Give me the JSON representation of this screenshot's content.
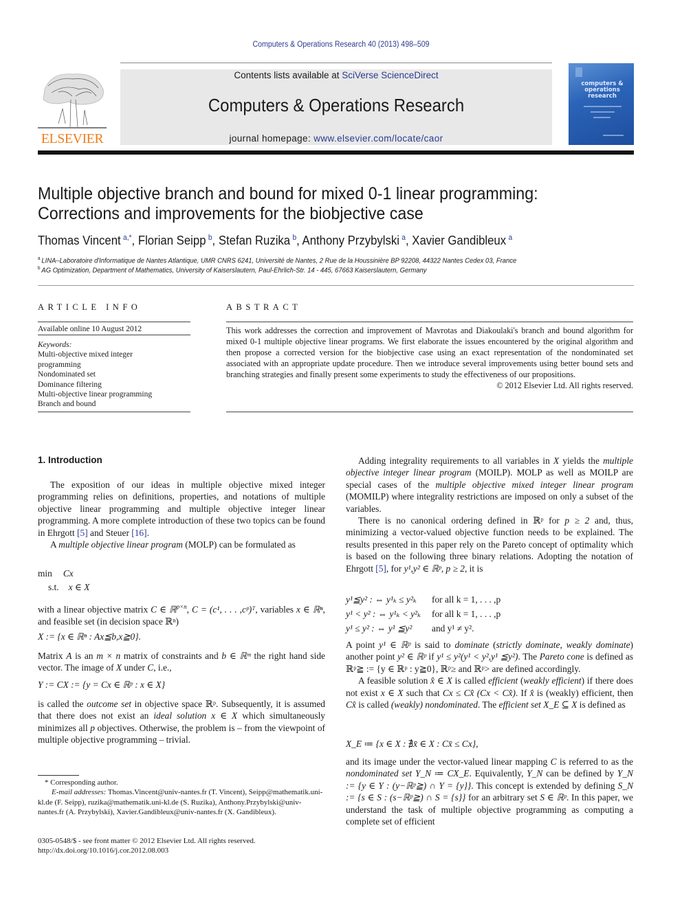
{
  "header": {
    "journal_reference": "Computers & Operations Research 40 (2013) 498–509",
    "contents_prefix": "Contents lists available at ",
    "contents_link": "SciVerse ScienceDirect",
    "journal_name": "Computers & Operations Research",
    "homepage_prefix": "journal homepage: ",
    "homepage_link": "www.elsevier.com/locate/caor",
    "publisher_logo_text": "ELSEVIER",
    "cover_title": "computers & operations research",
    "colors": {
      "link": "#2b3a8f",
      "elsevier_orange": "#f07d1a",
      "cover_blue": "#2b64b8"
    }
  },
  "article": {
    "title_line1": "Multiple objective branch and bound for mixed 0-1 linear programming:",
    "title_line2": "Corrections and improvements for the biobjective case",
    "authors": [
      {
        "name": "Thomas Vincent",
        "affil": "a,*"
      },
      {
        "name": "Florian Seipp",
        "affil": "b"
      },
      {
        "name": "Stefan Ruzika",
        "affil": "b"
      },
      {
        "name": "Anthony Przybylski",
        "affil": "a"
      },
      {
        "name": "Xavier Gandibleux",
        "affil": "a"
      }
    ],
    "affiliations": [
      {
        "mark": "a",
        "text": "LINA–Laboratoire d'Informatique de Nantes Atlantique, UMR CNRS 6241, Université de Nantes, 2 Rue de la Houssinière BP 92208, 44322 Nantes Cedex 03, France"
      },
      {
        "mark": "b",
        "text": "AG Optimization, Department of Mathematics, University of Kaiserslautern, Paul-Ehrlich-Str. 14 - 445, 67663 Kaiserslautern, Germany"
      }
    ]
  },
  "article_info": {
    "heading": "ARTICLE INFO",
    "available_online": "Available online 10 August 2012",
    "keywords_label": "Keywords:",
    "keywords": [
      "Multi-objective mixed integer",
      "programming",
      "Nondominated set",
      "Dominance filtering",
      "Multi-objective linear programming",
      "Branch and bound"
    ]
  },
  "abstract": {
    "heading": "ABSTRACT",
    "text": "This work addresses the correction and improvement of Mavrotas and Diakoulaki's branch and bound algorithm for mixed 0-1 multiple objective linear programs. We first elaborate the issues encountered by the original algorithm and then propose a corrected version for the biobjective case using an exact representation of the nondominated set associated with an appropriate update procedure. Then we introduce several improvements using better bound sets and branching strategies and finally present some experiments to study the effectiveness of our propositions.",
    "copyright": "© 2012 Elsevier Ltd. All rights reserved."
  },
  "left_column": {
    "section_heading": "1.  Introduction",
    "p1_a": "The exposition of our ideas in multiple objective mixed integer programming relies on definitions, properties, and notations of multiple objective linear programming and multiple objective integer linear programming. A more complete introduction of these two topics can be found in Ehrgott ",
    "ref5": "[5]",
    "p1_b": " and Steuer ",
    "ref16": "[16]",
    "p1_c": ".",
    "p2_a": "A ",
    "p2_em": "multiple objective linear program",
    "p2_b": " (MOLP) can be formulated as",
    "eq_min": "min",
    "eq_min_expr": "Cx",
    "eq_st": "s.t.",
    "eq_st_expr": "x ∈ X",
    "p3": "with a linear objective matrix C ∈ ℝ^{p×n}, C = (c¹, . . . ,cᵖ)ᵀ, variables x ∈ ℝⁿ, and feasible set (in decision space ℝⁿ)",
    "p3_a": "with a linear objective matrix ",
    "p3_m1": "C ∈ ℝ",
    "p3_m1_sup": "p×n",
    "p3_b": ", ",
    "p3_m2": "C = (c¹, . . . ,cᵖ)ᵀ",
    "p3_c": ", variables ",
    "p3_m3": "x ∈ ℝⁿ",
    "p3_d": ", and feasible set (in decision space ℝⁿ)",
    "eq_X": "X := {x ∈ ℝⁿ : Ax≦b,x≧0}.",
    "p4_a": "Matrix ",
    "p4_m1": "A",
    "p4_b": " is an ",
    "p4_m2": "m × n",
    "p4_c": " matrix of constraints and ",
    "p4_m3": "b ∈ ℝᵐ",
    "p4_d": " the right hand side vector. The image of ",
    "p4_m4": "X",
    "p4_e": " under ",
    "p4_m5": "C",
    "p4_f": ", i.e.,",
    "eq_Y": "Y := CX := {y = Cx ∈ ℝᵖ : x ∈ X}",
    "p5_a": "is called the ",
    "p5_em1": "outcome set",
    "p5_b": " in objective space ℝᵖ. Subsequently, it is assumed that there does not exist an ",
    "p5_em2": "ideal solution x ∈ X",
    "p5_c": " which simultaneously minimizes all ",
    "p5_m": "p",
    "p5_d": " objectives. Otherwise, the problem is – from the viewpoint of multiple objective programming – trivial."
  },
  "right_column": {
    "p1_a": "Adding integrality requirements to all variables in ",
    "p1_m": "X",
    "p1_b": " yields the ",
    "p1_em1": "multiple objective integer linear program",
    "p1_c": " (MOILP). MOLP as well as MOILP are special cases of the ",
    "p1_em2": "multiple objective mixed integer linear program",
    "p1_d": " (MOMILP) where integrality restrictions are imposed on only a subset of the variables.",
    "p2_a": "There is no canonical ordering defined in ℝᵖ for ",
    "p2_m": "p ≥ 2",
    "p2_b": " and, thus, minimizing a vector-valued objective function needs to be explained. The results presented in this paper rely on the Pareto concept of optimality which is based on the following three binary relations. Adopting the notation of Ehrgott ",
    "ref5": "[5]",
    "p2_c": ", for ",
    "p2_m2": "y¹,y² ∈ ℝᵖ, p ≥ 2",
    "p2_d": ", it is",
    "relations": [
      {
        "lhs": "y¹≦y² : ⇔ y¹ₖ ≤ y²ₖ",
        "rhs": "for all k = 1, . . . ,p"
      },
      {
        "lhs": "y¹ < y² : ⇔ y¹ₖ < y²ₖ",
        "rhs": "for all k = 1, . . . ,p"
      },
      {
        "lhs": "y¹ ≤ y² : ⇔ y¹ ≦y²",
        "rhs": "and y¹ ≠ y²."
      }
    ],
    "p3_a": "A point ",
    "p3_m1": "y¹ ∈ ℝᵖ",
    "p3_b": " is said to ",
    "p3_em1": "dominate",
    "p3_c": " (",
    "p3_em2": "strictly dominate",
    "p3_d": ", ",
    "p3_em3": "weakly dominate",
    "p3_e": ") another point ",
    "p3_m2": "y² ∈ ℝᵖ",
    "p3_f": " if ",
    "p3_m3": "y¹ ≤ y²(y¹ < y²,y¹ ≦y²)",
    "p3_g": ". The ",
    "p3_em4": "Pareto cone",
    "p3_h": " is defined as ℝᵖ≧ := {y ∈ ℝᵖ : y≧0}, ℝᵖ≥ and ℝᵖ> are defined accordingly.",
    "p4_a": "A feasible solution ",
    "p4_m1": "x̂ ∈ X",
    "p4_b": " is called ",
    "p4_em1": "efficient",
    "p4_c": " (",
    "p4_em2": "weakly efficient",
    "p4_d": ") if there does not exist ",
    "p4_m2": "x ∈ X",
    "p4_e": " such that ",
    "p4_m3": "Cx ≤ Cx̂ (Cx < Cx̂)",
    "p4_f": ". If ",
    "p4_m4": "x̂",
    "p4_g": " is (weakly) efficient, then ",
    "p4_m5": "Cx̂",
    "p4_h": " is called ",
    "p4_em3": "(weakly) nondominated",
    "p4_i": ". The ",
    "p4_em4": "efficient set",
    "p4_m6": " X_E ⊆ X",
    "p4_j": " is defined as",
    "eq_XE": "X_E ≔ {x ∈ X : ∄x̄ ∈ X : Cx̄ ≤ Cx},",
    "p5_a": "and its image under the vector-valued linear mapping ",
    "p5_m1": "C",
    "p5_b": " is referred to as the ",
    "p5_em1": "nondominated set",
    "p5_m2": " Y_N ≔ CX_E",
    "p5_c": ". Equivalently, ",
    "p5_m3": "Y_N",
    "p5_d": " can be defined by ",
    "p5_m4": "Y_N := {y ∈ Y : (y−ℝᵖ≧) ∩ Y = {y}}",
    "p5_e": ". This concept is extended by defining ",
    "p5_m5": "S_N := {s ∈ S : (s−ℝᵖ≧) ∩ S = {s}}",
    "p5_f": " for an arbitrary set ",
    "p5_m6": "S ∈ ℝᵖ",
    "p5_g": ". In this paper, we understand the task of multiple objective programming as computing a complete set of efficient"
  },
  "footnotes": {
    "corresponding": "* Corresponding author.",
    "email_label": "E-mail addresses:",
    "emails": " Thomas.Vincent@univ-nantes.fr (T. Vincent), Seipp@mathematik.uni-kl.de (F. Seipp), ruzika@mathematik.uni-kl.de (S. Ruzika), Anthony.Przybylski@univ-nantes.fr (A. Przybylski), Xavier.Gandibleux@univ-nantes.fr (X. Gandibleux).",
    "front_matter": "0305-0548/$ - see front matter © 2012 Elsevier Ltd. All rights reserved.",
    "doi": "http://dx.doi.org/10.1016/j.cor.2012.08.003"
  }
}
